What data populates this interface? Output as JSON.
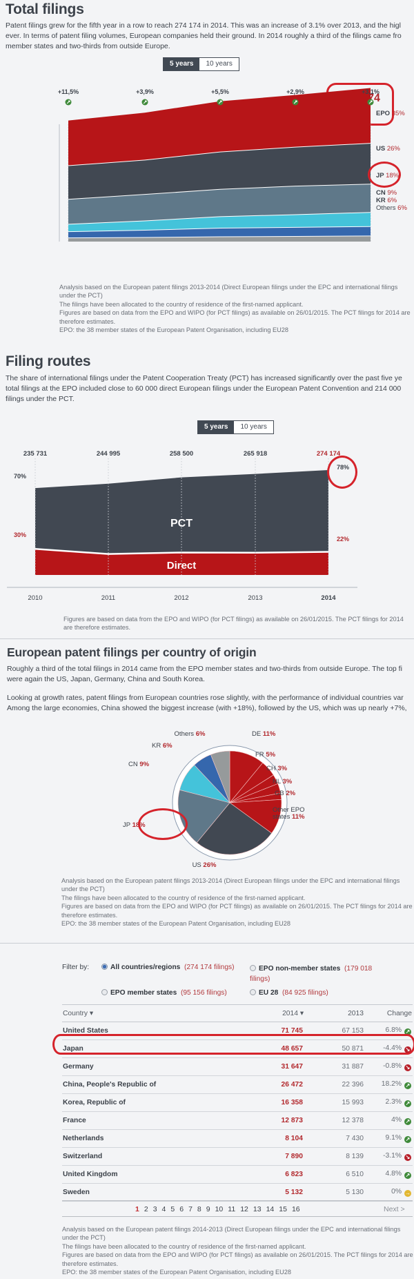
{
  "sections": {
    "total_filings": {
      "title": "Total filings",
      "intro": [
        "Patent filings grew for the fifth year in a row to reach 274 174 in 2014. This was an increase of 3.1% over 2013, and the higl",
        "ever. In terms of patent filing volumes, European companies held their ground. In 2014 roughly a third of the filings came fro",
        "member states and two-thirds from outside Europe."
      ],
      "toggle": {
        "active": "5 years",
        "inactive": "10 years"
      },
      "highlight_total": "274 174",
      "notes": [
        "Analysis based on the European patent filings 2013-2014 (Direct European filings under the EPC and international filings under the PCT)",
        "The filings have been allocated to the country of residence of the first-named applicant.",
        "Figures are based on data from the EPO and WIPO (for PCT filings) as available on 26/01/2015. The PCT filings for 2014 are therefore estimates.",
        "EPO: the 38 member states of the European Patent Organisation, including EU28"
      ]
    },
    "filing_routes": {
      "title": "Filing routes",
      "intro": [
        "The share of international filings under the Patent Cooperation Treaty (PCT) has increased significantly over the past five ye",
        "total filings at the EPO included close to 60 000 direct European filings under the European Patent Convention and 214 000",
        "filings under the PCT."
      ],
      "toggle": {
        "active": "5 years",
        "inactive": "10 years"
      },
      "notes": [
        "Figures are based on data from the EPO and WIPO (for PCT filings) as available on 26/01/2015. The PCT filings for 2014 are therefore estimates."
      ]
    },
    "per_country": {
      "title": "European patent filings per country of origin",
      "intro": [
        "Roughly a third of the total filings in 2014 came from the EPO member states and two-thirds from outside Europe. The top fi",
        "were again the US, Japan, Germany, China and South Korea.",
        "",
        "Looking at growth rates, patent filings from European countries rose slightly, with the performance of individual countries var",
        "Among the large economies, China showed the biggest increase (with +18%), followed by the US, which was up nearly +7%,"
      ],
      "notes": [
        "Analysis based on the European patent filings 2013-2014 (Direct European filings under the EPC and international filings under the PCT)",
        "The filings have been allocated to the country of residence of the first-named applicant.",
        "Figures are based on data from the EPO and WIPO (for PCT filings) as available on 26/01/2015. The PCT filings for 2014 are therefore estimates.",
        "EPO: the 38 member states of the European Patent Organisation, including EU28"
      ]
    },
    "table": {
      "filter_label": "Filter by:",
      "filters": [
        {
          "label": "All countries/regions",
          "count": "(274 174 filings)",
          "selected": true
        },
        {
          "label": "EPO non-member states",
          "count": "(179 018 filings)",
          "selected": false
        },
        {
          "label": "EPO member states",
          "count": "(95 156 filings)",
          "selected": false
        },
        {
          "label": "EU 28",
          "count": "(84 925 filings)",
          "selected": false
        }
      ],
      "headers": {
        "country": "Country ▾",
        "y2014": "2014 ▾",
        "y2013": "2013",
        "change": "Change"
      },
      "rows": [
        {
          "country": "United States",
          "y2014": "71 745",
          "y2013": "67 153",
          "change": "6.8%",
          "trend": "up"
        },
        {
          "country": "Japan",
          "y2014": "48 657",
          "y2013": "50 871",
          "change": "-4.4%",
          "trend": "down"
        },
        {
          "country": "Germany",
          "y2014": "31 647",
          "y2013": "31 887",
          "change": "-0.8%",
          "trend": "down"
        },
        {
          "country": "China, People's Republic of",
          "y2014": "26 472",
          "y2013": "22 396",
          "change": "18.2%",
          "trend": "up"
        },
        {
          "country": "Korea, Republic of",
          "y2014": "16 358",
          "y2013": "15 993",
          "change": "2.3%",
          "trend": "up"
        },
        {
          "country": "France",
          "y2014": "12 873",
          "y2013": "12 378",
          "change": "4%",
          "trend": "up"
        },
        {
          "country": "Netherlands",
          "y2014": "8 104",
          "y2013": "7 430",
          "change": "9.1%",
          "trend": "up"
        },
        {
          "country": "Switzerland",
          "y2014": "7 890",
          "y2013": "8 139",
          "change": "-3.1%",
          "trend": "down"
        },
        {
          "country": "United Kingdom",
          "y2014": "6 823",
          "y2013": "6 510",
          "change": "4.8%",
          "trend": "up"
        },
        {
          "country": "Sweden",
          "y2014": "5 132",
          "y2013": "5 130",
          "change": "0%",
          "trend": "flat"
        }
      ],
      "highlighted_row": "Japan",
      "pagination": {
        "pages": [
          "1",
          "2",
          "3",
          "4",
          "5",
          "6",
          "7",
          "8",
          "9",
          "10",
          "11",
          "12",
          "13",
          "14",
          "15",
          "16"
        ],
        "current": "1",
        "next": "Next >"
      },
      "notes": [
        "Analysis based on the European patent filings 2014-2013 (Direct European filings under the EPC and international filings under the PCT)",
        "The filings have been allocated to the country of residence of the first-named applicant.",
        "Figures are based on data from the EPO and WIPO (for PCT filings) as available on 26/01/2015. The PCT filings for 2014 are therefore estimates.",
        "EPO: the 38 member states of the European Patent Organisation, including EU28"
      ]
    }
  },
  "colors": {
    "red": "#b71518",
    "dark": "#414852",
    "slate": "#5f7889",
    "cyan": "#44c3da",
    "blue": "#3567ad",
    "grey": "#969a9b",
    "accent_text": "#b2282d",
    "up": "#3f8a3a",
    "down": "#b8202a",
    "flat": "#e2b731"
  },
  "chart_data": [
    {
      "type": "area",
      "stacked": true,
      "title": "Total filings",
      "x": [
        "2010",
        "2011",
        "2012",
        "2013",
        "2014"
      ],
      "growth_labels": [
        "+11,5%",
        "+3,9%",
        "+5,5%",
        "+2,9%",
        "+3,1%"
      ],
      "totals": [
        235731,
        244995,
        258500,
        265918,
        274174
      ],
      "series": [
        {
          "name": "Others",
          "label": "Others",
          "share_2014": "6%",
          "color": "#969a9b",
          "values": [
            0.06,
            0.06,
            0.06,
            0.06,
            0.06
          ]
        },
        {
          "name": "KR",
          "label": "KR",
          "share_2014": "6%",
          "color": "#3567ad",
          "values": [
            0.05,
            0.055,
            0.06,
            0.06,
            0.06
          ]
        },
        {
          "name": "CN",
          "label": "CN",
          "share_2014": "9%",
          "color": "#44c3da",
          "values": [
            0.06,
            0.07,
            0.08,
            0.085,
            0.09
          ]
        },
        {
          "name": "JP",
          "label": "JP",
          "share_2014": "18%",
          "color": "#5f7889",
          "values": [
            0.2,
            0.2,
            0.19,
            0.19,
            0.18
          ]
        },
        {
          "name": "US",
          "label": "US",
          "share_2014": "26%",
          "color": "#414852",
          "values": [
            0.27,
            0.26,
            0.26,
            0.26,
            0.26
          ]
        },
        {
          "name": "EPO",
          "label": "EPO",
          "share_2014": "35%",
          "color": "#b71518",
          "values": [
            0.36,
            0.355,
            0.35,
            0.345,
            0.35
          ]
        }
      ],
      "legend": "right",
      "grid": "vertical-dotted"
    },
    {
      "type": "area",
      "stacked": true,
      "title": "Filing routes",
      "x": [
        "2010",
        "2011",
        "2012",
        "2013",
        "2014"
      ],
      "totals": [
        "235 731",
        "244 995",
        "258 500",
        "265 918",
        "274 174"
      ],
      "totals_numeric": [
        235731,
        244995,
        258500,
        265918,
        274174
      ],
      "series": [
        {
          "name": "Direct",
          "color": "#b71518",
          "share": [
            0.3,
            0.23,
            0.23,
            0.22,
            0.22
          ],
          "start_label": "30%",
          "end_label": "22%"
        },
        {
          "name": "PCT",
          "color": "#414852",
          "share": [
            0.7,
            0.77,
            0.77,
            0.78,
            0.78
          ],
          "start_label": "70%",
          "end_label": "78%"
        }
      ],
      "grid": "vertical-dotted"
    },
    {
      "type": "pie",
      "title": "European patent filings per country of origin",
      "slices": [
        {
          "label": "DE",
          "value": 11,
          "text": "11%",
          "color": "#b71518"
        },
        {
          "label": "FR",
          "value": 5,
          "text": "5%",
          "color": "#b71518"
        },
        {
          "label": "CH",
          "value": 3,
          "text": "3%",
          "color": "#b71518"
        },
        {
          "label": "NL",
          "value": 3,
          "text": "3%",
          "color": "#b71518"
        },
        {
          "label": "GB",
          "value": 2,
          "text": "2%",
          "color": "#b71518"
        },
        {
          "label": "Other EPO states",
          "value": 11,
          "text": "11%",
          "color": "#b71518"
        },
        {
          "label": "US",
          "value": 26,
          "text": "26%",
          "color": "#414852"
        },
        {
          "label": "JP",
          "value": 18,
          "text": "18%",
          "color": "#5f7889"
        },
        {
          "label": "CN",
          "value": 9,
          "text": "9%",
          "color": "#44c3da"
        },
        {
          "label": "KR",
          "value": 6,
          "text": "6%",
          "color": "#3567ad"
        },
        {
          "label": "Others",
          "value": 6,
          "text": "6%",
          "color": "#969a9b"
        }
      ]
    }
  ]
}
